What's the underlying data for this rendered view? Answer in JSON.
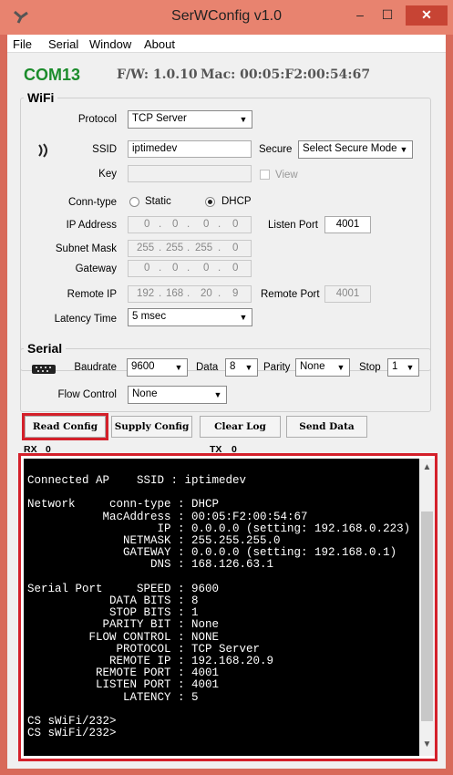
{
  "window": {
    "title": "SerWConfig v1.0",
    "minimize": "–",
    "maximize": "☐",
    "close": "✕"
  },
  "menu": [
    "File",
    "Serial",
    "Window",
    "About"
  ],
  "device": {
    "port": "COM13",
    "firmware": "F/W: 1.0.10",
    "mac": "Mac: 00:05:F2:00:54:67"
  },
  "wifi": {
    "legend": "WiFi",
    "protocol_label": "Protocol",
    "protocol": "TCP Server",
    "ssid_label": "SSID",
    "ssid": "iptimedev",
    "secure_label": "Secure",
    "secure": "Select Secure Mode",
    "key_label": "Key",
    "key": "",
    "view_label": "View",
    "conntype_label": "Conn-type",
    "static_label": "Static",
    "dhcp_label": "DHCP",
    "ip_label": "IP Address",
    "ip": [
      "0",
      "0",
      "0",
      "0"
    ],
    "listen_port_label": "Listen Port",
    "listen_port": "4001",
    "subnet_label": "Subnet Mask",
    "subnet": [
      "255",
      "255",
      "255",
      "0"
    ],
    "gateway_label": "Gateway",
    "gateway": [
      "0",
      "0",
      "0",
      "0"
    ],
    "remote_ip_label": "Remote IP",
    "remote_ip": [
      "192",
      "168",
      "20",
      "9"
    ],
    "remote_port_label": "Remote Port",
    "remote_port": "4001",
    "latency_label": "Latency Time",
    "latency": "5 msec"
  },
  "serial": {
    "legend": "Serial",
    "baud_label": "Baudrate",
    "baud": "9600",
    "data_label": "Data",
    "data": "8",
    "parity_label": "Parity",
    "parity": "None",
    "stop_label": "Stop",
    "stop": "1",
    "flow_label": "Flow Control",
    "flow": "None"
  },
  "buttons": {
    "read": "Read Config",
    "supply": "Supply Config",
    "clear": "Clear Log",
    "send": "Send Data"
  },
  "counters": {
    "rx_label": "RX",
    "rx": "0",
    "tx_label": "TX",
    "tx": "0"
  },
  "console": [
    "Connected AP    SSID : iptimedev",
    "",
    "Network     conn-type : DHCP",
    "           MacAddress : 00:05:F2:00:54:67",
    "                   IP : 0.0.0.0 (setting: 192.168.0.223)",
    "              NETMASK : 255.255.255.0",
    "              GATEWAY : 0.0.0.0 (setting: 192.168.0.1)",
    "                  DNS : 168.126.63.1",
    "",
    "Serial Port     SPEED : 9600",
    "            DATA BITS : 8",
    "            STOP BITS : 1",
    "           PARITY BIT : None",
    "         FLOW CONTROL : NONE",
    "             PROTOCOL : TCP Server",
    "            REMOTE IP : 192.168.20.9",
    "          REMOTE PORT : 4001",
    "          LISTEN PORT : 4001",
    "              LATENCY : 5",
    "",
    "CS sWiFi/232>",
    "CS sWiFi/232>"
  ]
}
